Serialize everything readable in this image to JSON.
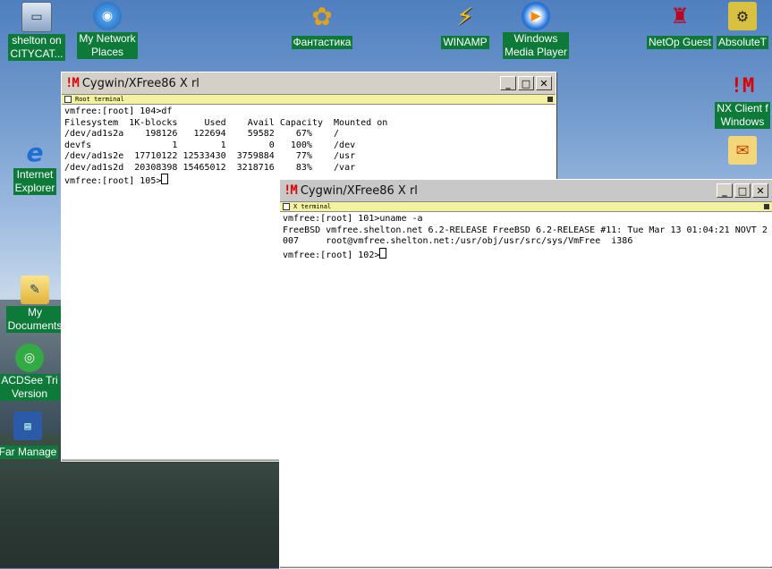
{
  "desktop": {
    "icons": [
      {
        "label": "shelton on\nCITYCAT...",
        "icon": "computer-icon"
      },
      {
        "label": "My Network\nPlaces",
        "icon": "network-icon"
      },
      {
        "label": "Фантастика",
        "icon": "msn-butterfly-icon"
      },
      {
        "label": "WINAMP",
        "icon": "winamp-icon"
      },
      {
        "label": "Windows\nMedia Player",
        "icon": "media-player-icon"
      },
      {
        "label": "NetOp Guest",
        "icon": "netop-icon"
      },
      {
        "label": "AbsoluteT",
        "icon": "absolute-icon"
      },
      {
        "label": "NX Client f\nWindows",
        "icon": "nx-icon"
      },
      {
        "label": "Internet\nExplorer",
        "icon": "ie-icon"
      },
      {
        "label": "My\nDocuments",
        "icon": "documents-icon"
      },
      {
        "label": "ACDSee Tri\nVersion",
        "icon": "acdsee-icon"
      },
      {
        "label": "Far Manage",
        "icon": "far-icon"
      }
    ]
  },
  "window1": {
    "title": "Cygwin/XFree86 X rl",
    "inner_title": "Root terminal",
    "lines": [
      "vmfree:[root] 104>df",
      "Filesystem  1K-blocks     Used    Avail Capacity  Mounted on",
      "/dev/ad1s2a    198126   122694    59582    67%    /",
      "devfs               1        1        0   100%    /dev",
      "/dev/ad1s2e  17710122 12533430  3759884    77%    /usr",
      "/dev/ad1s2d  20308398 15465012  3218716    83%    /var",
      "vmfree:[root] 105>"
    ]
  },
  "window2": {
    "title": "Cygwin/XFree86 X rl",
    "inner_title": "X terminal",
    "lines": [
      "vmfree:[root] 101>uname -a",
      "FreeBSD vmfree.shelton.net 6.2-RELEASE FreeBSD 6.2-RELEASE #11: Tue Mar 13 01:04:21 NOVT 2",
      "007     root@vmfree.shelton.net:/usr/obj/usr/src/sys/VmFree  i386",
      "vmfree:[root] 102>"
    ]
  },
  "controls": {
    "minimize": "_",
    "maximize": "□",
    "close": "✕"
  }
}
